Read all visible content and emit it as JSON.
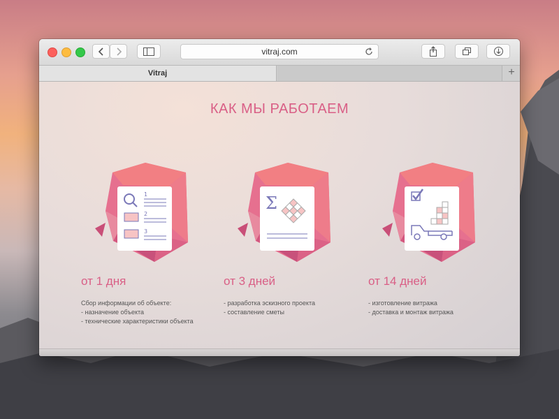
{
  "browser": {
    "url": "vitraj.com",
    "tabs": [
      {
        "label": "Vitraj",
        "active": true
      },
      {
        "label": "",
        "active": false
      }
    ],
    "new_tab_label": "+"
  },
  "page": {
    "heading": "КАК МЫ РАБОТАЕМ",
    "accent_color": "#d95f86",
    "steps": [
      {
        "time": "от 1 дня",
        "icon": "document-search-icon",
        "lines": [
          "Сбор  информации об объекте:",
          "- назначение объекта",
          "- технические характеристики объекта"
        ]
      },
      {
        "time": "от 3 дней",
        "icon": "sum-grid-icon",
        "lines": [
          "- разработка эскизного проекта",
          "- составление сметы"
        ]
      },
      {
        "time": "от 14 дней",
        "icon": "truck-delivery-icon",
        "lines": [
          "- изготовление витража",
          "- доставка и монтаж витража"
        ]
      }
    ]
  }
}
